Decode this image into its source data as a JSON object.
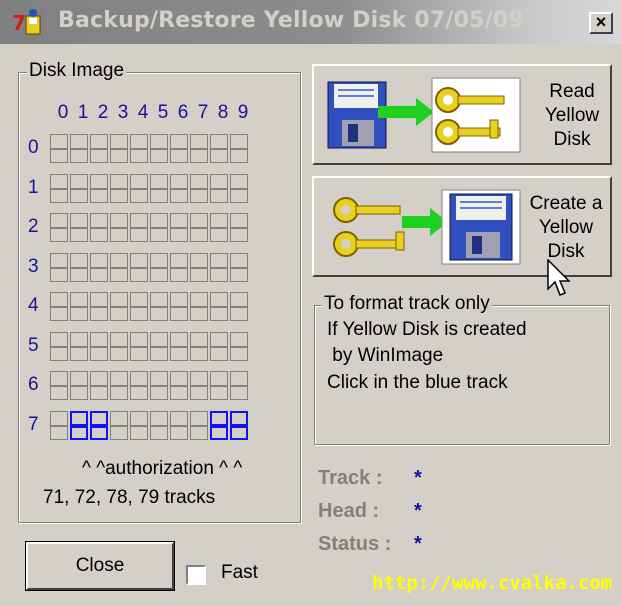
{
  "window": {
    "title": "Backup/Restore Yellow Disk 07/05/09",
    "close_glyph": "×"
  },
  "disk_image": {
    "group_label": "Disk Image",
    "column_headers": [
      "0",
      "1",
      "2",
      "3",
      "4",
      "5",
      "6",
      "7",
      "8",
      "9"
    ],
    "row_headers": [
      "0",
      "1",
      "2",
      "3",
      "4",
      "5",
      "6",
      "7"
    ],
    "highlighted_tracks": [
      "71",
      "72",
      "78",
      "79"
    ],
    "authorization_text": "^ ^authorization ^ ^",
    "tracks_text": "71, 72, 78, 79 tracks"
  },
  "buttons": {
    "read_label_lines": [
      "Read",
      "Yellow",
      "Disk"
    ],
    "create_label_lines": [
      "Create a",
      "Yellow",
      "Disk"
    ],
    "close_label": "Close"
  },
  "format_box": {
    "group_label": "To format track only",
    "lines": [
      "If Yellow Disk is created",
      " by WinImage",
      "Click in the blue track"
    ]
  },
  "status": {
    "track_label": "Track :",
    "track_value": "*",
    "head_label": "Head :",
    "head_value": "*",
    "status_label": "Status :",
    "status_value": "*"
  },
  "fast_checkbox": {
    "label": "Fast",
    "checked": false
  },
  "footer": {
    "url": "http://www.cvalka.com"
  },
  "colors": {
    "face": "#d4d0c8",
    "blue_text": "#1414a0",
    "blue_track": "#1010ff",
    "key_yellow": "#e8d020",
    "arrow_green": "#20d020",
    "url_yellow": "#ffff00"
  }
}
